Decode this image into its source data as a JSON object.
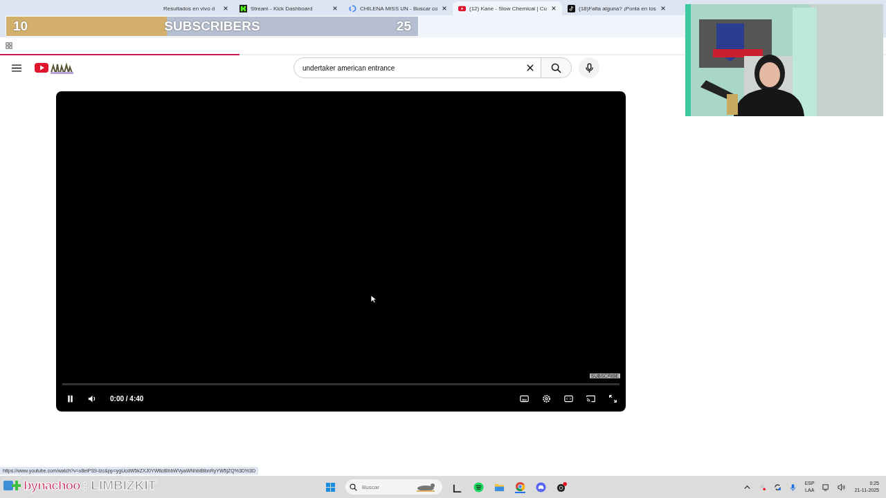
{
  "browser": {
    "tabs": [
      {
        "kind": "results",
        "title": "Resultados en vivo d",
        "selected": false
      },
      {
        "kind": "kick",
        "title": "Stream - Kick Dashboard",
        "selected": false
      },
      {
        "kind": "google",
        "title": "CHILENA MISS UN - Buscar co",
        "selected": false
      },
      {
        "kind": "youtube",
        "title": "(12) Kane - Slow Chemical | Cu",
        "selected": true
      },
      {
        "kind": "tiktok",
        "title": "(18)Falta alguna? ¡Ponla en los",
        "selected": false
      }
    ],
    "load_progress": {
      "level": 0.27
    }
  },
  "youtube": {
    "search": {
      "value": "undertaker american entrance"
    }
  },
  "player": {
    "playing": true,
    "time": "0:00 / 4:40",
    "watermark": "SUBSCRIBE"
  },
  "status_url": "https://www.youtube.com/watch?v=o8eiPS9-tzc&pp=ygUcdW5kZXJ0YWtlciBhbWVyaWNhbiBlbnRyYW5jZQ%3D%3D",
  "taskbar": {
    "search_placeholder": "Buscar",
    "language": "ESP",
    "layout": "LAA",
    "time": "0:25",
    "date": "21-11-2025"
  },
  "stream_overlays": {
    "goal": {
      "current": "10",
      "label": "SUBSCRIBERS",
      "target": "25",
      "level": 0.39
    },
    "credit": {
      "name": "bynachoo",
      "separator": ": LIMBIZKIT"
    }
  }
}
